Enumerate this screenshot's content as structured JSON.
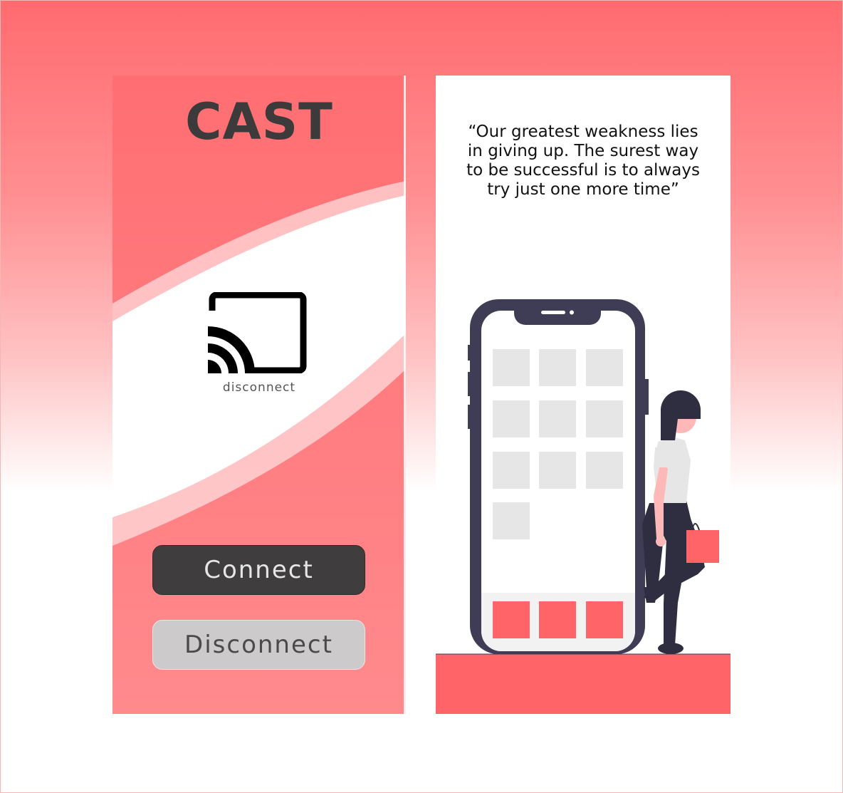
{
  "app": {
    "title": "CAST"
  },
  "cast": {
    "icon": "cast-icon",
    "caption": "disconnect"
  },
  "buttons": {
    "connect_label": "Connect",
    "disconnect_label": "Disconnect"
  },
  "quote": {
    "text": "“Our greatest weakness lies in giving up. The surest way to be successful is to always try just one more time”"
  },
  "illustration": {
    "subject": "person-leaning-on-phone",
    "tile_count": 10,
    "dock_tile_count": 3
  },
  "colors": {
    "accent": "#ff6468",
    "dark": "#3f3d56",
    "button_dark": "#403d3e",
    "button_light": "#cdcacb",
    "tile": "#e6e6e6"
  }
}
